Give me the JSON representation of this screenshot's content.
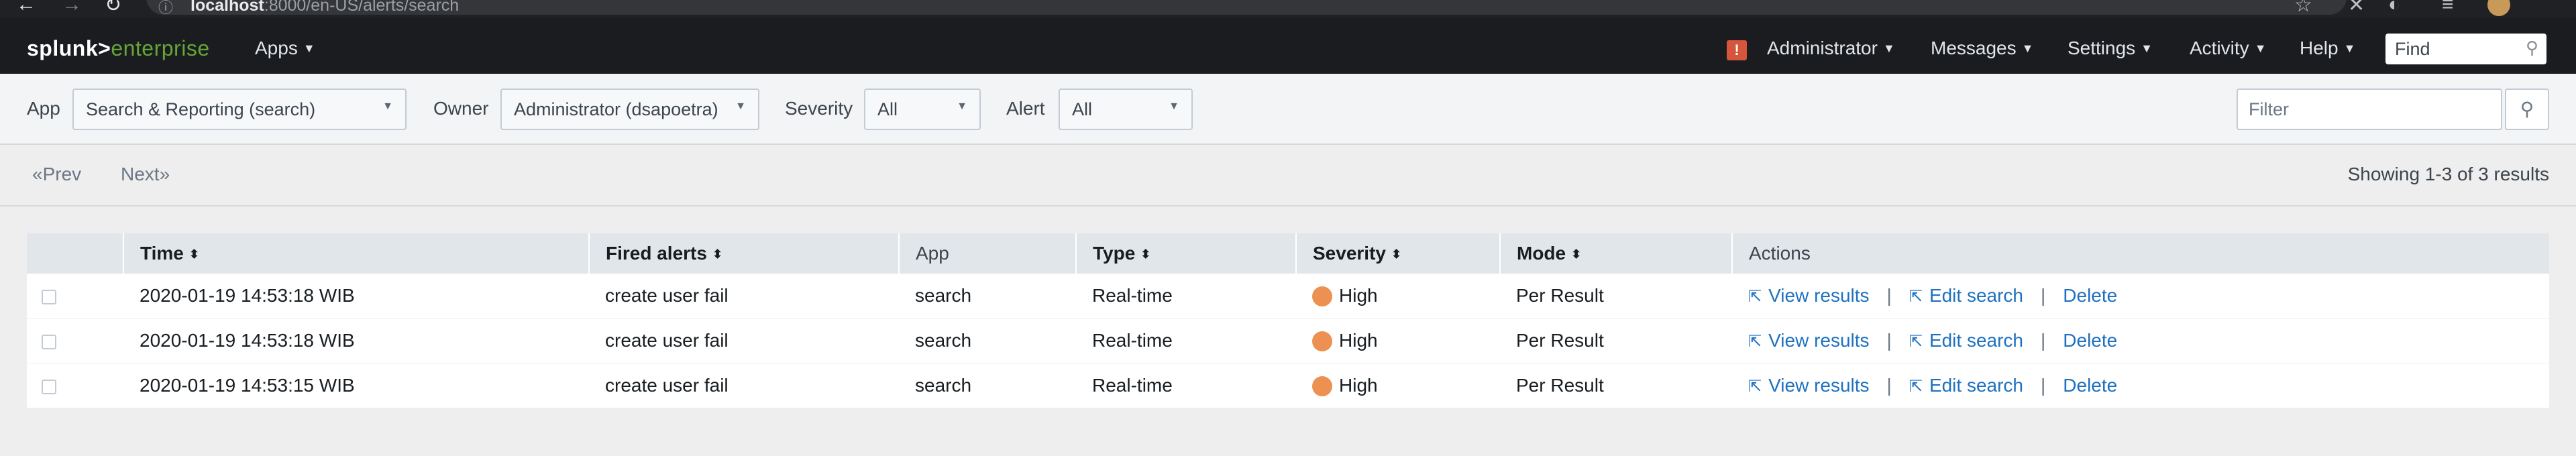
{
  "browser": {
    "url_host": "localhost",
    "url_path": ":8000/en-US/alerts/search"
  },
  "topbar": {
    "logo_a": "splunk>",
    "logo_b": "enterprise",
    "apps": "Apps",
    "user": "Administrator",
    "messages": "Messages",
    "settings": "Settings",
    "activity": "Activity",
    "help": "Help",
    "find_placeholder": "Find",
    "badge": "!"
  },
  "filters": {
    "app_label": "App",
    "app_value": "Search & Reporting (search)",
    "owner_label": "Owner",
    "owner_value": "Administrator (dsapoetra)",
    "severity_label": "Severity",
    "severity_value": "All",
    "alert_label": "Alert",
    "alert_value": "All",
    "filter_placeholder": "Filter"
  },
  "pager": {
    "prev": "«Prev",
    "next": "Next»",
    "showing": "Showing 1-3 of 3 results"
  },
  "table": {
    "headers": {
      "time": "Time",
      "fired": "Fired alerts",
      "app": "App",
      "type": "Type",
      "severity": "Severity",
      "mode": "Mode",
      "actions": "Actions"
    },
    "action_labels": {
      "view": "View results",
      "edit": "Edit search",
      "delete": "Delete",
      "sep": "|"
    },
    "rows": [
      {
        "time": "2020-01-19 14:53:18 WIB",
        "fired": "create user fail",
        "app": "search",
        "type": "Real-time",
        "severity": "High",
        "mode": "Per Result"
      },
      {
        "time": "2020-01-19 14:53:18 WIB",
        "fired": "create user fail",
        "app": "search",
        "type": "Real-time",
        "severity": "High",
        "mode": "Per Result"
      },
      {
        "time": "2020-01-19 14:53:15 WIB",
        "fired": "create user fail",
        "app": "search",
        "type": "Real-time",
        "severity": "High",
        "mode": "Per Result"
      }
    ]
  },
  "colors": {
    "severity_high": "#ec9152",
    "link": "#1e71c0",
    "brand_green": "#65a637",
    "alert_badge": "#d6563c"
  }
}
